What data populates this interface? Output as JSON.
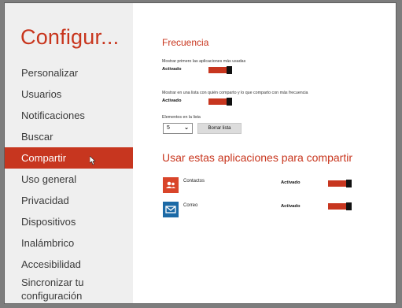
{
  "sidebar": {
    "title": "Configur...",
    "items": [
      {
        "label": "Personalizar"
      },
      {
        "label": "Usuarios"
      },
      {
        "label": "Notificaciones"
      },
      {
        "label": "Buscar"
      },
      {
        "label": "Compartir",
        "selected": true
      },
      {
        "label": "Uso general"
      },
      {
        "label": "Privacidad"
      },
      {
        "label": "Dispositivos"
      },
      {
        "label": "Inalámbrico"
      },
      {
        "label": "Accesibilidad"
      },
      {
        "label": "Sincronizar tu configuración"
      }
    ]
  },
  "frecuencia": {
    "title": "Frecuencia",
    "setting1": {
      "label": "Mostrar primero las aplicaciones más usadas",
      "status": "Activado",
      "on": true
    },
    "setting2": {
      "label": "Mostrar en una lista con quién comparto y lo que comparto con más frecuencia",
      "status": "Activado",
      "on": true
    },
    "elements": {
      "label": "Elementos en la lista",
      "value": "5"
    },
    "clear_button": "Borrar lista"
  },
  "apps": {
    "title": "Usar estas aplicaciones para compartir",
    "items": [
      {
        "name": "Contactos",
        "status": "Activado",
        "on": true,
        "icon": "people-icon",
        "color": "#d9452a"
      },
      {
        "name": "Correo",
        "status": "Activado",
        "on": true,
        "icon": "mail-icon",
        "color": "#1c6aa6"
      }
    ]
  },
  "colors": {
    "accent": "#c7361f",
    "sidebar_bg": "#efefef"
  }
}
